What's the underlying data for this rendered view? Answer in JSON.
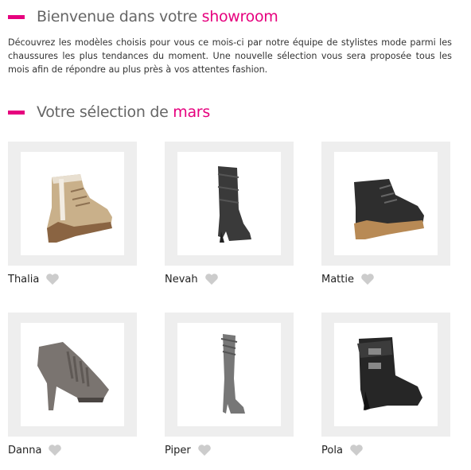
{
  "welcome": {
    "title_prefix": "Bienvenue dans votre ",
    "title_accent": "showroom",
    "intro": "Découvrez les modèles choisis pour vous ce mois-ci par notre équipe de stylistes mode parmi les chaussures les plus tendances du moment. Une nouvelle sélection vous sera proposée tous les mois afin de répondre au plus près à vos attentes fashion."
  },
  "selection": {
    "title_prefix": "Votre sélection de ",
    "title_accent": "mars"
  },
  "products": [
    {
      "name": "Thalia",
      "style": "beige-wedge-ankle-boot"
    },
    {
      "name": "Nevah",
      "style": "black-slouch-mid-boot"
    },
    {
      "name": "Mattie",
      "style": "black-wedge-ankle-boot"
    },
    {
      "name": "Danna",
      "style": "grey-fringe-peep-toe-bootie"
    },
    {
      "name": "Piper",
      "style": "grey-over-knee-boot"
    },
    {
      "name": "Pola",
      "style": "black-buckle-ankle-boot"
    }
  ],
  "colors": {
    "accent": "#e6007e",
    "heart": "#cccccc",
    "card_frame": "#eeeeee"
  }
}
